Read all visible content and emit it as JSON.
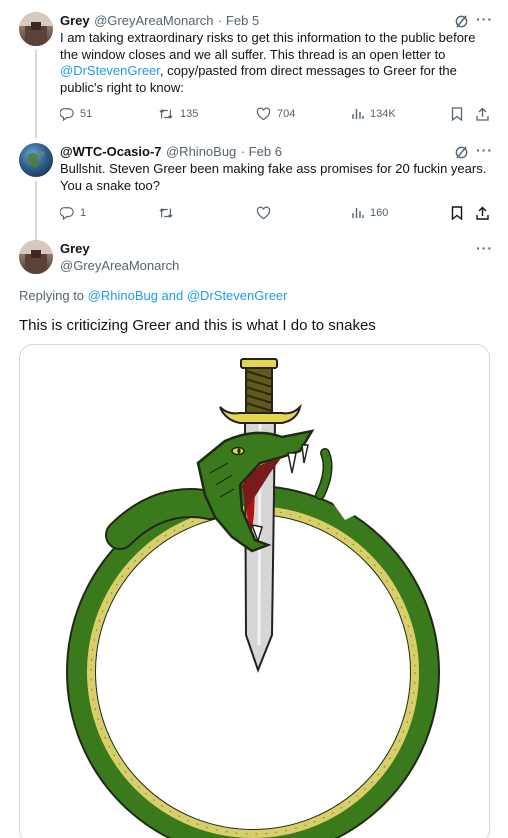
{
  "tweet1": {
    "name": "Grey",
    "handle": "@GreyAreaMonarch",
    "date": "· Feb 5",
    "text_lines": [
      "I am taking extraordinary risks to get this information to the public before",
      "the window closes and we all suffer. This thread is an open letter to"
    ],
    "mention": "@DrStevenGreer",
    "text_after_mention": ", copy/pasted from direct messages to Greer for the",
    "text_last": "public's right to know:",
    "replies": "51",
    "retweets": "135",
    "likes": "704",
    "views": "134K"
  },
  "tweet2": {
    "name": "@WTC-Ocasio-7",
    "handle": "@RhinoBug",
    "date": "· Feb 6",
    "text_lines": [
      "Bullshit.  Steven Greer been making fake ass promises for 20 fuckin years.",
      "You a snake too?"
    ],
    "replies": "1",
    "views": "160"
  },
  "tweet3": {
    "name": "Grey",
    "handle": "@GreyAreaMonarch",
    "replying_prefix": "Replying to ",
    "replying_to": "@RhinoBug and @DrStevenGreer",
    "text": "This is criticizing Greer  and this is what I do to snakes"
  },
  "colors": {
    "accent": "#1d9bf0",
    "muted": "#536471",
    "snake_green": "#3b7a1c",
    "snake_belly": "#d8cf6a"
  }
}
